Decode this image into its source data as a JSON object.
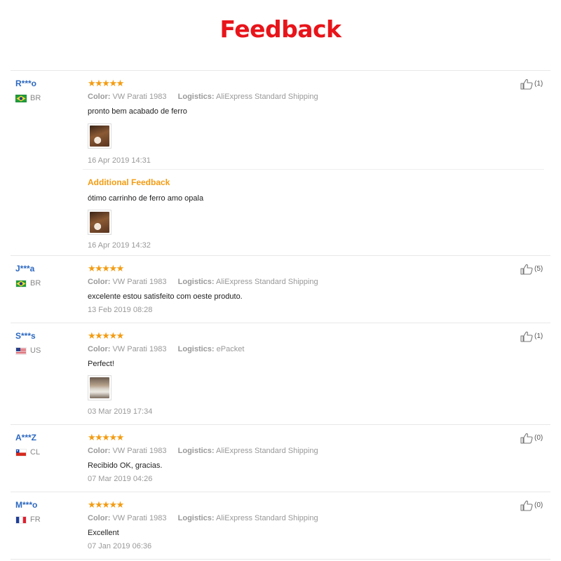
{
  "page": {
    "title": "Feedback"
  },
  "labels": {
    "color_key": "Color:",
    "logistics_key": "Logistics:",
    "additional_feedback": "Additional Feedback"
  },
  "colors": {
    "accent": "#e8141a",
    "star": "#f39c12",
    "username": "#2c68c0"
  },
  "reviews": [
    {
      "user": "R***o",
      "country": "BR",
      "flag": "br-flag",
      "stars": 5,
      "color": "VW Parati 1983",
      "logistics": "AliExpress Standard Shipping",
      "text": "pronto bem acabado de ferro",
      "date": "16 Apr 2019 14:31",
      "helpful_count": "(1)",
      "additional": {
        "text": "ótimo carrinho de ferro amo opala",
        "date": "16 Apr 2019 14:32"
      }
    },
    {
      "user": "J***a",
      "country": "BR",
      "flag": "br-flag",
      "stars": 5,
      "color": "VW Parati 1983",
      "logistics": "AliExpress Standard Shipping",
      "text": "excelente estou satisfeito com oeste produto.",
      "date": "13 Feb 2019 08:28",
      "helpful_count": "(5)"
    },
    {
      "user": "S***s",
      "country": "US",
      "flag": "us-flag",
      "stars": 5,
      "color": "VW Parati 1983",
      "logistics": "ePacket",
      "text": "Perfect!",
      "date": "03 Mar 2019 17:34",
      "helpful_count": "(1)"
    },
    {
      "user": "A***Z",
      "country": "CL",
      "flag": "cl-flag",
      "stars": 5,
      "color": "VW Parati 1983",
      "logistics": "AliExpress Standard Shipping",
      "text": "Recibido OK, gracias.",
      "date": "07 Mar 2019 04:26",
      "helpful_count": "(0)"
    },
    {
      "user": "M***o",
      "country": "FR",
      "flag": "fr-flag",
      "stars": 5,
      "color": "VW Parati 1983",
      "logistics": "AliExpress Standard Shipping",
      "text": "Excellent",
      "date": "07 Jan 2019 06:36",
      "helpful_count": "(0)"
    }
  ]
}
